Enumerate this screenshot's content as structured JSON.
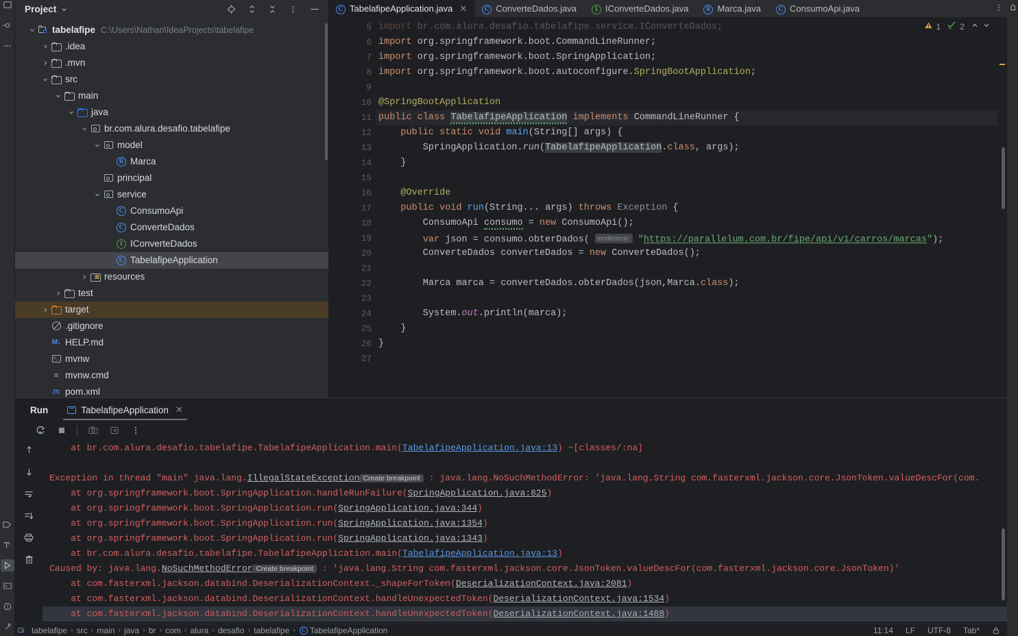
{
  "project_panel": {
    "title": "Project",
    "toolbar_icons": [
      "locate-icon",
      "expand-collapse-icon",
      "collapse-all-icon",
      "more-options-icon",
      "minimize-icon"
    ],
    "tree": [
      {
        "depth": 0,
        "twist": "down",
        "icon": "module-icon",
        "label": "tabelafipe",
        "bold": true,
        "path": "C:\\Users\\Nathan\\IdeaProjects\\tabelafipe"
      },
      {
        "depth": 1,
        "twist": "right",
        "icon": "folder-icon",
        "label": ".idea"
      },
      {
        "depth": 1,
        "twist": "right",
        "icon": "folder-icon",
        "label": ".mvn"
      },
      {
        "depth": 1,
        "twist": "down",
        "icon": "folder-icon",
        "label": "src"
      },
      {
        "depth": 2,
        "twist": "down",
        "icon": "folder-icon",
        "label": "main"
      },
      {
        "depth": 3,
        "twist": "down",
        "icon": "source-folder-icon",
        "label": "java"
      },
      {
        "depth": 4,
        "twist": "down",
        "icon": "package-icon",
        "label": "br.com.alura.desafio.tabelafipe"
      },
      {
        "depth": 5,
        "twist": "down",
        "icon": "package-icon",
        "label": "model"
      },
      {
        "depth": 6,
        "twist": "none",
        "icon": "record-icon",
        "label": "Marca"
      },
      {
        "depth": 5,
        "twist": "none",
        "icon": "package-icon",
        "label": "principal"
      },
      {
        "depth": 5,
        "twist": "down",
        "icon": "package-icon",
        "label": "service"
      },
      {
        "depth": 6,
        "twist": "none",
        "icon": "class-icon",
        "label": "ConsumoApi"
      },
      {
        "depth": 6,
        "twist": "none",
        "icon": "class-icon",
        "label": "ConverteDados"
      },
      {
        "depth": 6,
        "twist": "none",
        "icon": "interface-icon",
        "label": "IConverteDados"
      },
      {
        "depth": 6,
        "twist": "none",
        "icon": "class-icon",
        "label": "TabelafipeApplication",
        "selected": true
      },
      {
        "depth": 4,
        "twist": "right",
        "icon": "resources-folder-icon",
        "label": "resources"
      },
      {
        "depth": 2,
        "twist": "right",
        "icon": "folder-icon",
        "label": "test"
      },
      {
        "depth": 1,
        "twist": "right",
        "icon": "excluded-folder-icon",
        "label": "target",
        "highlight": true
      },
      {
        "depth": 1,
        "twist": "none",
        "icon": "gitignore-icon",
        "label": ".gitignore"
      },
      {
        "depth": 1,
        "twist": "none",
        "icon": "markdown-icon",
        "label": "HELP.md"
      },
      {
        "depth": 1,
        "twist": "none",
        "icon": "shell-script-icon",
        "label": "mvnw"
      },
      {
        "depth": 1,
        "twist": "none",
        "icon": "text-file-icon",
        "label": "mvnw.cmd"
      },
      {
        "depth": 1,
        "twist": "none",
        "icon": "maven-icon",
        "label": "pom.xml"
      }
    ]
  },
  "editor": {
    "tabs": [
      {
        "label": "TabelafipeApplication.java",
        "icon": "class-icon",
        "active": true,
        "closable": true
      },
      {
        "label": "ConverteDados.java",
        "icon": "class-icon",
        "active": false
      },
      {
        "label": "IConverteDados.java",
        "icon": "interface-icon",
        "active": false
      },
      {
        "label": "Marca.java",
        "icon": "record-icon",
        "active": false
      },
      {
        "label": "ConsumoApi.java",
        "icon": "class-icon",
        "active": false
      }
    ],
    "inspection": {
      "warning_count": "1",
      "check_count": "2",
      "warning_icon": "warning-triangle-icon",
      "ok_icon": "checkmark-icon",
      "prev_icon": "chevron-up-icon",
      "next_icon": "chevron-down-icon"
    },
    "first_visible_line": 5,
    "lines": [
      {
        "n": 5,
        "clipped": true
      },
      {
        "n": 6
      },
      {
        "n": 7
      },
      {
        "n": 8
      },
      {
        "n": 9
      },
      {
        "n": 10
      },
      {
        "n": 11,
        "gutter_icon": "run-gutter-icon"
      },
      {
        "n": 12,
        "gutter_icon": "run-gutter-icon"
      },
      {
        "n": 13
      },
      {
        "n": 14
      },
      {
        "n": 15
      },
      {
        "n": 16
      },
      {
        "n": 17,
        "gutter_icon": "override-gutter-icon"
      },
      {
        "n": 18
      },
      {
        "n": 19
      },
      {
        "n": 20
      },
      {
        "n": 21
      },
      {
        "n": 22
      },
      {
        "n": 23
      },
      {
        "n": 24
      },
      {
        "n": 25
      },
      {
        "n": 26
      },
      {
        "n": 27
      }
    ],
    "code_text": {
      "l6": "import org.springframework.boot.CommandLineRunner;",
      "l7": "import org.springframework.boot.SpringApplication;",
      "l8": "import org.springframework.boot.autoconfigure.SpringBootApplication;",
      "l10": "@SpringBootApplication",
      "l11": "public class TabelafipeApplication implements CommandLineRunner {",
      "l12": "    public static void main(String[] args) {",
      "l13": "        SpringApplication.run(TabelafipeApplication.class, args);",
      "l14": "    }",
      "l16": "    @Override",
      "l17": "    public void run(String... args) throws Exception {",
      "l18": "        ConsumoApi consumo = new ConsumoApi();",
      "l19": "        var json = consumo.obterDados( endereco: \"https://parallelum.com.br/fipe/api/v1/carros/marcas\");",
      "l19_hint": "endereco:",
      "l19_url": "https://parallelum.com.br/fipe/api/v1/carros/marcas",
      "l20": "        ConverteDados converteDados = new ConverteDados();",
      "l22": "        Marca marca = converteDados.obterDados(json,Marca.class);",
      "l24": "        System.out.println(marca);",
      "l25": "    }",
      "l26": "}"
    }
  },
  "run_panel": {
    "title": "Run",
    "tab_label": "TabelafipeApplication",
    "tab_icon": "run-configuration-icon",
    "tab_close_icon": "close-icon",
    "toolbar_icons": [
      "rerun-icon",
      "stop-icon",
      "screenshot-icon",
      "export-icon",
      "more-options-icon"
    ],
    "side_icons": [
      "scroll-up-icon",
      "scroll-down-icon",
      "soft-wrap-icon",
      "scroll-to-end-icon",
      "print-icon",
      "clear-all-icon"
    ],
    "console_lines": [
      {
        "segments": [
          {
            "t": "    at br.com.alura.desafio.tabelafipe.TabelafipeApplication.main(",
            "c": "err"
          },
          {
            "t": "TabelafipeApplication.java:13",
            "c": "lnk"
          },
          {
            "t": ") ~[classes/:na]",
            "c": "err"
          }
        ]
      },
      {
        "segments": [
          {
            "t": "",
            "c": "err"
          }
        ]
      },
      {
        "segments": [
          {
            "t": "Exception in thread \"main\" java.lang.",
            "c": "err"
          },
          {
            "t": "IllegalStateException",
            "c": "lnk-grey"
          },
          {
            "t": " Create breakpoint ",
            "c": "bp"
          },
          {
            "t": " : java.lang.NoSuchMethodError: 'java.lang.String com.fasterxml.jackson.core.JsonToken.valueDescFor(com.",
            "c": "err"
          }
        ]
      },
      {
        "segments": [
          {
            "t": "    at org.springframework.boot.SpringApplication.handleRunFailure(",
            "c": "err"
          },
          {
            "t": "SpringApplication.java:825",
            "c": "lnk-grey"
          },
          {
            "t": ")",
            "c": "err"
          }
        ]
      },
      {
        "segments": [
          {
            "t": "    at org.springframework.boot.SpringApplication.run(",
            "c": "err"
          },
          {
            "t": "SpringApplication.java:344",
            "c": "lnk-grey"
          },
          {
            "t": ")",
            "c": "err"
          }
        ]
      },
      {
        "segments": [
          {
            "t": "    at org.springframework.boot.SpringApplication.run(",
            "c": "err"
          },
          {
            "t": "SpringApplication.java:1354",
            "c": "lnk-grey"
          },
          {
            "t": ")",
            "c": "err"
          }
        ]
      },
      {
        "segments": [
          {
            "t": "    at org.springframework.boot.SpringApplication.run(",
            "c": "err"
          },
          {
            "t": "SpringApplication.java:1343",
            "c": "lnk-grey"
          },
          {
            "t": ")",
            "c": "err"
          }
        ]
      },
      {
        "segments": [
          {
            "t": "    at br.com.alura.desafio.tabelafipe.TabelafipeApplication.main(",
            "c": "err"
          },
          {
            "t": "TabelafipeApplication.java:13",
            "c": "lnk"
          },
          {
            "t": ")",
            "c": "err"
          }
        ]
      },
      {
        "segments": [
          {
            "t": "Caused by: java.lang.",
            "c": "err"
          },
          {
            "t": "NoSuchMethodError",
            "c": "lnk-grey"
          },
          {
            "t": " Create breakpoint ",
            "c": "bp"
          },
          {
            "t": " : 'java.lang.String com.fasterxml.jackson.core.JsonToken.valueDescFor(com.fasterxml.jackson.core.JsonToken)'",
            "c": "err"
          }
        ]
      },
      {
        "segments": [
          {
            "t": "    at com.fasterxml.jackson.databind.DeserializationContext._shapeForToken(",
            "c": "err"
          },
          {
            "t": "DeserializationContext.java:2081",
            "c": "lnk-grey"
          },
          {
            "t": ")",
            "c": "err"
          }
        ]
      },
      {
        "segments": [
          {
            "t": "    at com.fasterxml.jackson.databind.DeserializationContext.handleUnexpectedToken(",
            "c": "err"
          },
          {
            "t": "DeserializationContext.java:1534",
            "c": "lnk-grey"
          },
          {
            "t": ")",
            "c": "err"
          }
        ]
      },
      {
        "segments": [
          {
            "t": "    at com.fasterxml.jackson.databind.DeserializationContext.handleUnexpectedToken(",
            "c": "err"
          },
          {
            "t": "DeserializationContext.java:1488",
            "c": "lnk-grey"
          },
          {
            "t": ")",
            "c": "err"
          }
        ]
      }
    ]
  },
  "status_bar": {
    "breadcrumbs": [
      "tabelafipe",
      "src",
      "main",
      "java",
      "br",
      "com",
      "alura",
      "desafio",
      "tabelafipe",
      "TabelafipeApplication"
    ],
    "breadcrumb_last_icon": "class-icon",
    "caret_position": "11:14",
    "line_separator": "LF",
    "encoding": "UTF-8",
    "indent": "Tab*",
    "lock_icon": "lock-icon"
  },
  "colors": {
    "bg": "#1e1f22",
    "panel_bg": "#2b2d30",
    "selection": "#43454a",
    "target_highlight": "#4a3b26",
    "accent_blue": "#3574f0",
    "error_red": "#cf5a5a",
    "string_green": "#6aab73",
    "keyword_orange": "#cf8e6d",
    "annotation_yellow": "#b3ae60",
    "link_blue": "#5a9ae8"
  }
}
